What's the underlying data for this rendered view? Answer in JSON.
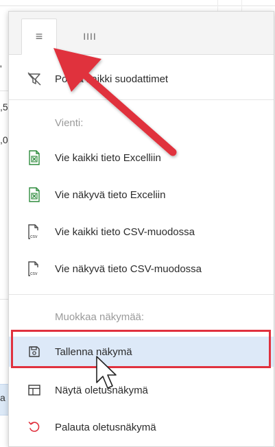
{
  "background": {
    "cell_fragments": [
      ",5",
      ",0",
      "a"
    ],
    "top_marker": "'"
  },
  "tabs": [
    {
      "name": "general-menu-tab",
      "icon": "hamburger-icon",
      "glyph": "≡",
      "active": true
    },
    {
      "name": "columns-tab",
      "icon": "columns-icon",
      "glyph": "IIII",
      "active": false
    }
  ],
  "menu": {
    "clear_filters_label": "Poista kaikki suodattimet",
    "export_section_label": "Vienti:",
    "export_items": [
      {
        "label": "Vie kaikki tieto Excelliin",
        "icon": "excel-icon"
      },
      {
        "label": "Vie näkyvä tieto Exceliin",
        "icon": "excel-icon"
      },
      {
        "label": "Vie kaikki tieto CSV-muodossa",
        "icon": "csv-icon"
      },
      {
        "label": "Vie näkyvä tieto CSV-muodossa",
        "icon": "csv-icon"
      }
    ],
    "view_section_label": "Muokkaa näkymää:",
    "view_items": [
      {
        "label": "Tallenna näkymä",
        "icon": "save-icon",
        "highlighted": true
      },
      {
        "label": "Näytä oletusnäkymä",
        "icon": "table-layout-icon",
        "highlighted": false
      },
      {
        "label": "Palauta oletusnäkymä",
        "icon": "reset-icon",
        "highlighted": false
      }
    ]
  },
  "colors": {
    "excel_green": "#2e8b3d",
    "reset_red": "#e0313e",
    "highlight_bg": "#dde9f8",
    "annotation_red": "#e0313e",
    "section_gray": "#9a9a9a"
  }
}
